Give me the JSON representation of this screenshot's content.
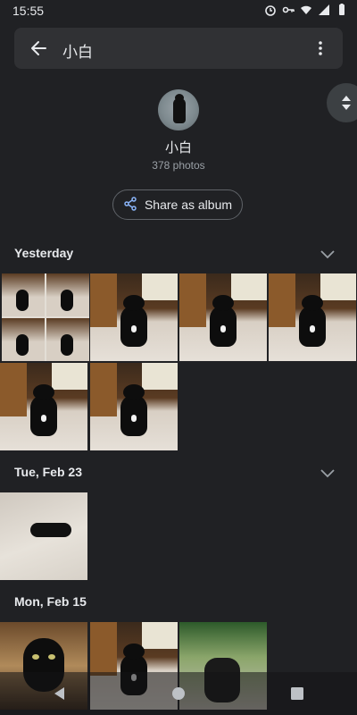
{
  "status_bar": {
    "time": "15:55",
    "icons": [
      "alarm-icon",
      "vpn-key-icon",
      "wifi-icon",
      "signal-icon",
      "battery-icon"
    ]
  },
  "search_bar": {
    "title": "小白",
    "back_icon": "arrow-left-icon",
    "more_icon": "more-vertical-icon"
  },
  "profile": {
    "name": "小白",
    "photo_count": "378 photos"
  },
  "share_button": {
    "label": "Share as album",
    "icon": "share-icon",
    "accent": "#8ab4f8"
  },
  "sections": [
    {
      "title": "Yesterday",
      "photos": 6
    },
    {
      "title": "Tue, Feb 23",
      "photos": 1
    },
    {
      "title": "Mon, Feb 15",
      "photos": 3
    }
  ],
  "nav_bar": {
    "buttons": [
      "back-triangle-icon",
      "home-circle-icon",
      "recents-square-icon"
    ]
  },
  "colors": {
    "background": "#202124",
    "surface": "#303134",
    "text": "#e8eaed",
    "secondary_text": "#9aa0a6"
  }
}
